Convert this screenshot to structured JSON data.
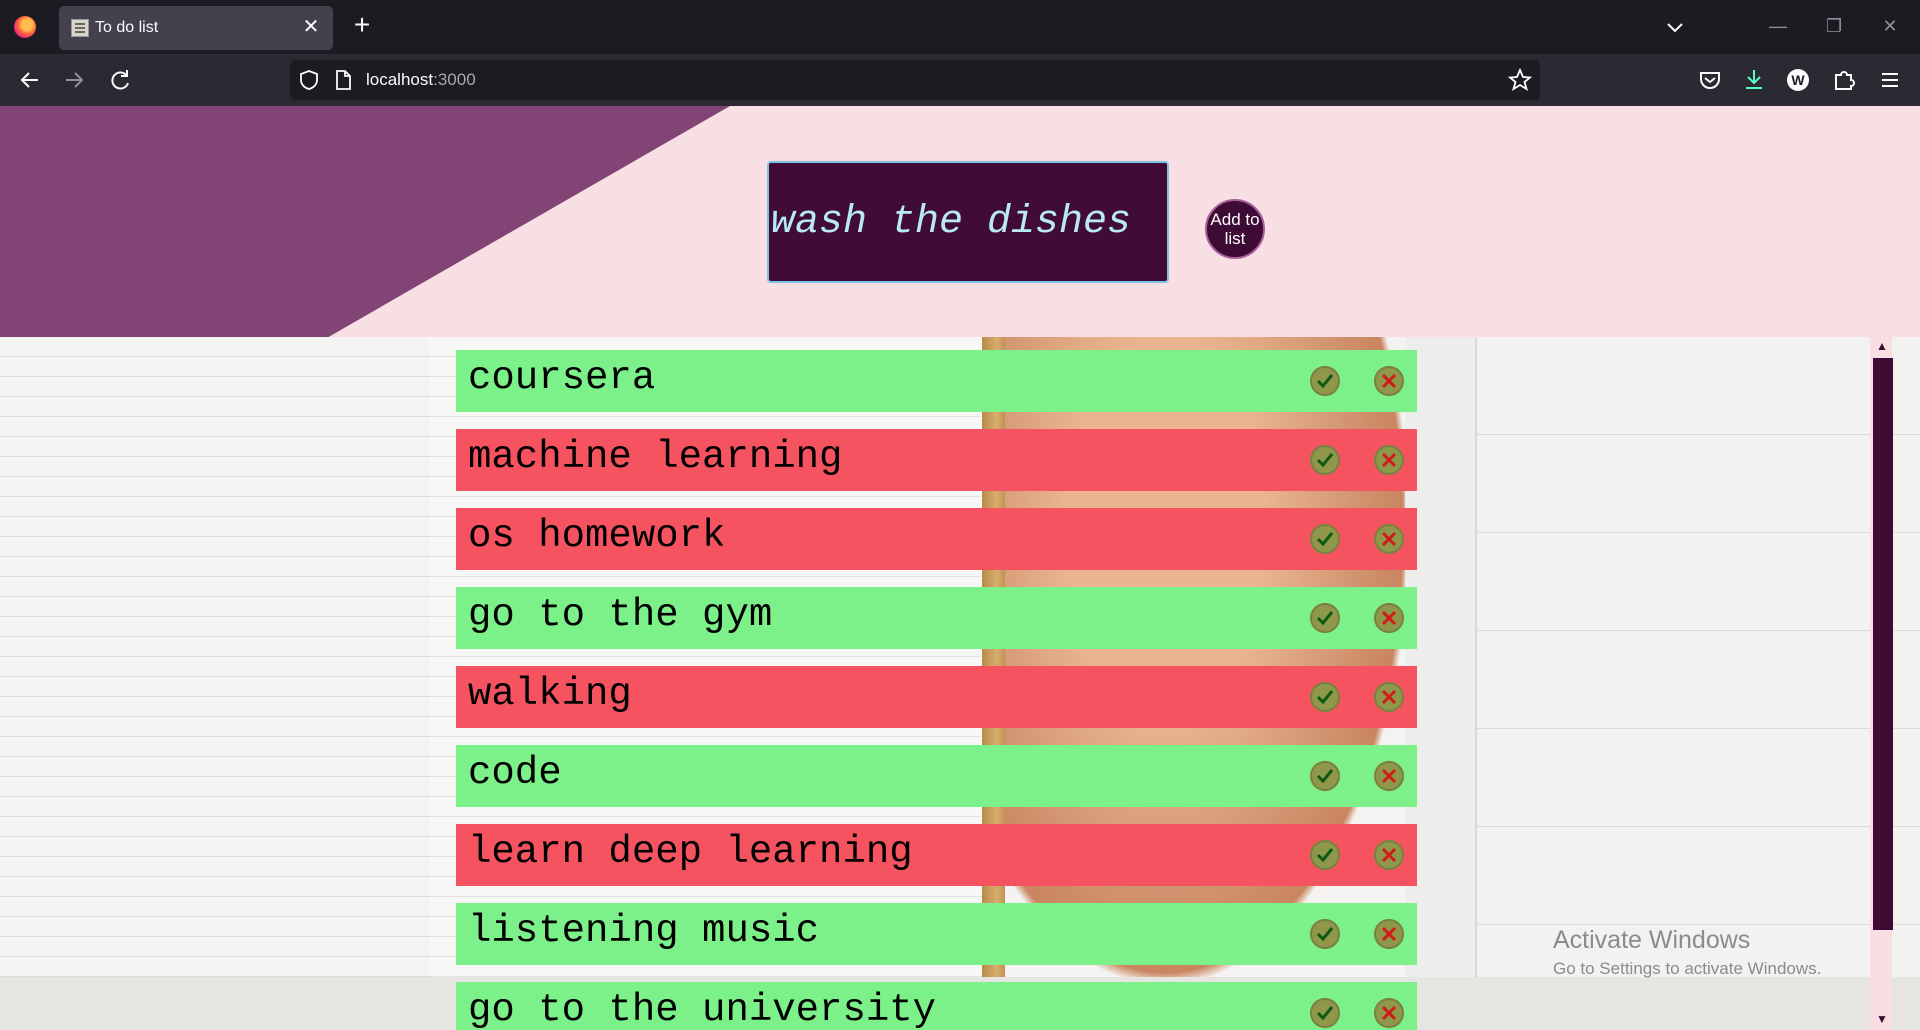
{
  "browser": {
    "tab_title": "To do list",
    "url_host": "localhost",
    "url_port": ":3000"
  },
  "form": {
    "input_value": "wash the dishes",
    "add_button_label": "Add to list"
  },
  "todos": [
    {
      "text": "coursera",
      "state": "done"
    },
    {
      "text": "machine learning",
      "state": "todo"
    },
    {
      "text": "os homework",
      "state": "todo"
    },
    {
      "text": "go to the gym",
      "state": "done"
    },
    {
      "text": "walking",
      "state": "todo"
    },
    {
      "text": "code",
      "state": "done"
    },
    {
      "text": "learn deep learning",
      "state": "todo"
    },
    {
      "text": "listening music",
      "state": "done"
    },
    {
      "text": "go to the university",
      "state": "done"
    }
  ],
  "colors": {
    "done": "#7cf089",
    "todo": "#f4535f",
    "header_bg": "#f8dfe3",
    "header_triangle": "#824474",
    "input_bg": "#400b35"
  },
  "watermark": {
    "title": "Activate Windows",
    "subtitle": "Go to Settings to activate Windows."
  }
}
